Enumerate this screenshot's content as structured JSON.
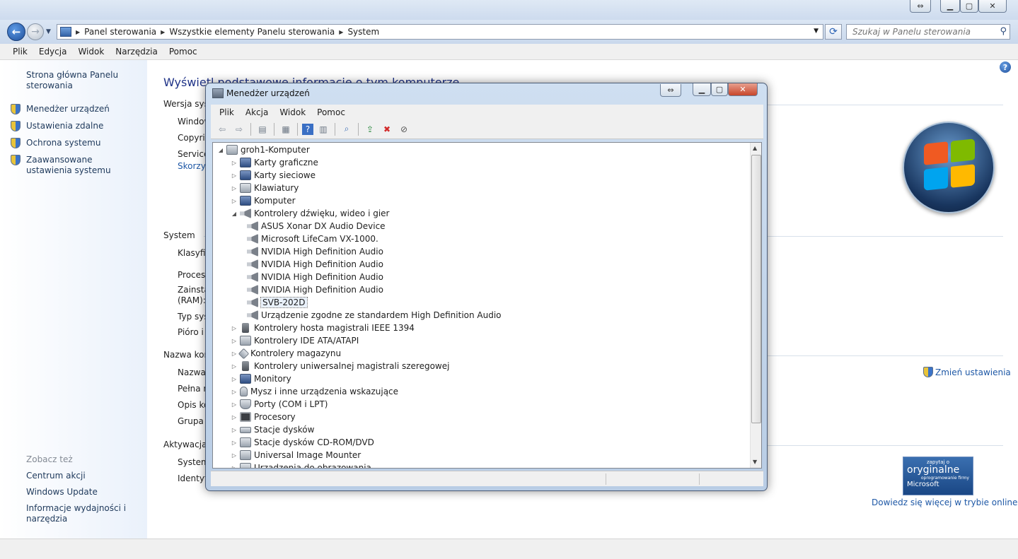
{
  "address_bar": {
    "breadcrumbs": [
      "Panel sterowania",
      "Wszystkie elementy Panelu sterowania",
      "System"
    ],
    "search_placeholder": "Szukaj w Panelu sterowania"
  },
  "menu": [
    "Plik",
    "Edycja",
    "Widok",
    "Narzędzia",
    "Pomoc"
  ],
  "left_pane": {
    "home_link": "Strona główna Panelu sterowania",
    "tasks": [
      "Menedżer urządzeń",
      "Ustawienia zdalne",
      "Ochrona systemu",
      "Zaawansowane ustawienia systemu"
    ],
    "see_also_label": "Zobacz też",
    "see_also": [
      "Centrum akcji",
      "Windows Update",
      "Informacje wydajności i narzędzia"
    ]
  },
  "content": {
    "title": "Wyświetl podstawowe informacje o tym komputerze",
    "sections": {
      "edition": "Wersja syst",
      "system": "System",
      "name": "Nazwa kom",
      "activation": "Aktywacja s"
    },
    "edition_rows": [
      "Window",
      "Copyrig",
      "Service"
    ],
    "edition_link": "Skorzys",
    "system_rows": [
      "Klasyfik",
      "Proceso",
      "Zainsta",
      "(RAM):",
      "Typ sys",
      "Pióro i"
    ],
    "name_rows": [
      "Nazwa",
      "Pełna n",
      "Opis ko",
      "Grupa r"
    ],
    "activation_rows": [
      "System",
      "Identyfi"
    ],
    "change_settings": "Zmień ustawienia",
    "genuine": {
      "line1": "zapytaj o",
      "line2": "oryginalne",
      "line3": "oprogramowanie firmy",
      "line4": "Microsoft"
    },
    "online_link": "Dowiedz się więcej w trybie online..."
  },
  "device_manager": {
    "title": "Menedżer urządzeń",
    "menu": [
      "Plik",
      "Akcja",
      "Widok",
      "Pomoc"
    ],
    "root": "groh1-Komputer",
    "categories_before": [
      "Karty graficzne",
      "Karty sieciowe",
      "Klawiatury",
      "Komputer"
    ],
    "expanded_category": "Kontrolery dźwięku, wideo i gier",
    "expanded_children": [
      "ASUS Xonar DX Audio Device",
      "Microsoft LifeCam VX-1000.",
      "NVIDIA High Definition Audio",
      "NVIDIA High Definition Audio",
      "NVIDIA High Definition Audio",
      "NVIDIA High Definition Audio",
      "SVB-202D",
      "Urządzenie zgodne ze standardem High Definition Audio"
    ],
    "selected_child": "SVB-202D",
    "categories_after": [
      "Kontrolery hosta magistrali IEEE 1394",
      "Kontrolery IDE ATA/ATAPI",
      "Kontrolery magazynu",
      "Kontrolery uniwersalnej magistrali szeregowej",
      "Monitory",
      "Mysz i inne urządzenia wskazujące",
      "Porty (COM i LPT)",
      "Procesory",
      "Stacje dysków",
      "Stacje dysków CD-ROM/DVD",
      "Universal Image Mounter",
      "Urządzenia do obrazowania"
    ]
  }
}
